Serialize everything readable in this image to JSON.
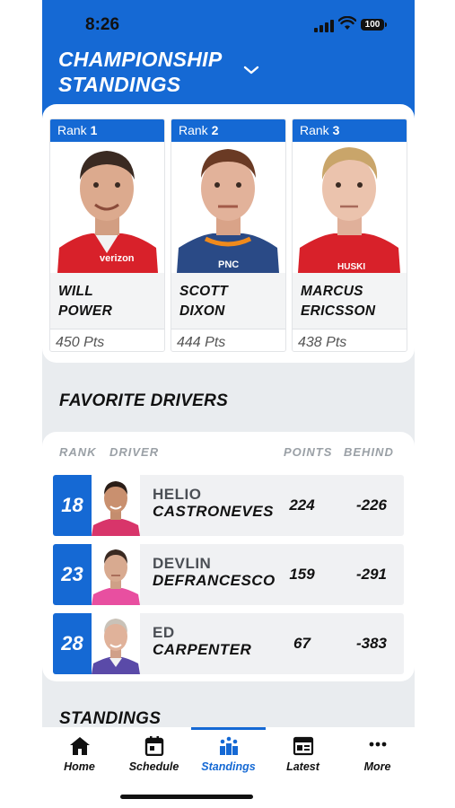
{
  "status_bar": {
    "time": "8:26",
    "battery": "100"
  },
  "header": {
    "title_line1": "CHAMPIONSHIP",
    "title_line2": "STANDINGS"
  },
  "top_three": [
    {
      "rank_label": "Rank",
      "rank": "1",
      "first": "WILL",
      "last": "POWER",
      "points": "450 Pts",
      "suit_color": "#d8212a",
      "text_on_suit": "verizon"
    },
    {
      "rank_label": "Rank",
      "rank": "2",
      "first": "SCOTT",
      "last": "DIXON",
      "points": "444 Pts",
      "suit_color": "#2a4a86",
      "text_on_suit": "PNC"
    },
    {
      "rank_label": "Rank",
      "rank": "3",
      "first": "MARCUS",
      "last": "ERICSSON",
      "points": "438 Pts",
      "suit_color": "#d8212a",
      "text_on_suit": "HUSKI"
    }
  ],
  "favorites": {
    "title": "FAVORITE DRIVERS",
    "columns": {
      "rank": "RANK",
      "driver": "DRIVER",
      "points": "POINTS",
      "behind": "BEHIND"
    },
    "rows": [
      {
        "rank": "18",
        "first": "HELIO",
        "last": "CASTRONEVES",
        "points": "224",
        "behind": "-226"
      },
      {
        "rank": "23",
        "first": "DEVLIN",
        "last": "DEFRANCESCO",
        "points": "159",
        "behind": "-291"
      },
      {
        "rank": "28",
        "first": "ED",
        "last": "CARPENTER",
        "points": "67",
        "behind": "-383"
      }
    ]
  },
  "standings": {
    "title": "STANDINGS"
  },
  "tabs": [
    {
      "label": "Home",
      "icon": "home-icon"
    },
    {
      "label": "Schedule",
      "icon": "calendar-icon"
    },
    {
      "label": "Standings",
      "icon": "standings-icon",
      "active": true
    },
    {
      "label": "Latest",
      "icon": "news-icon"
    },
    {
      "label": "More",
      "icon": "more-icon"
    }
  ],
  "colors": {
    "brand_blue": "#1569d4",
    "background": "#e9ecef"
  }
}
